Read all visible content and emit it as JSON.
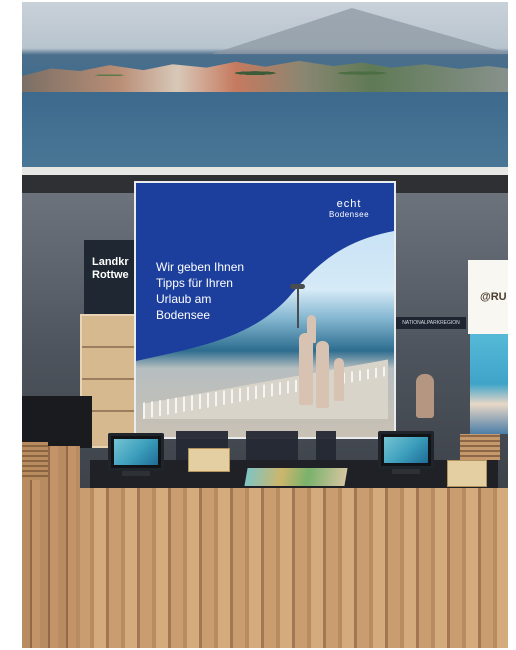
{
  "scene": {
    "poster": {
      "brand_main": "echt",
      "brand_sub": "Bodensee",
      "headline": "Wir geben Ihnen\nTipps für Ihren\nUrlaub am\nBodensee"
    },
    "left_sign": {
      "text": "Landkr\nRottwe"
    },
    "right_logo": "@RU",
    "right_small_sign": "NATIONALPARKREGION"
  },
  "icons": {
    "tablet_left": "tablet-icon",
    "tablet_right": "tablet-icon"
  },
  "colors": {
    "poster_blue": "#1c3f9d",
    "lake_blue": "#3d6a8d",
    "wood": "#c99d70",
    "desk_black": "#1f2126"
  }
}
